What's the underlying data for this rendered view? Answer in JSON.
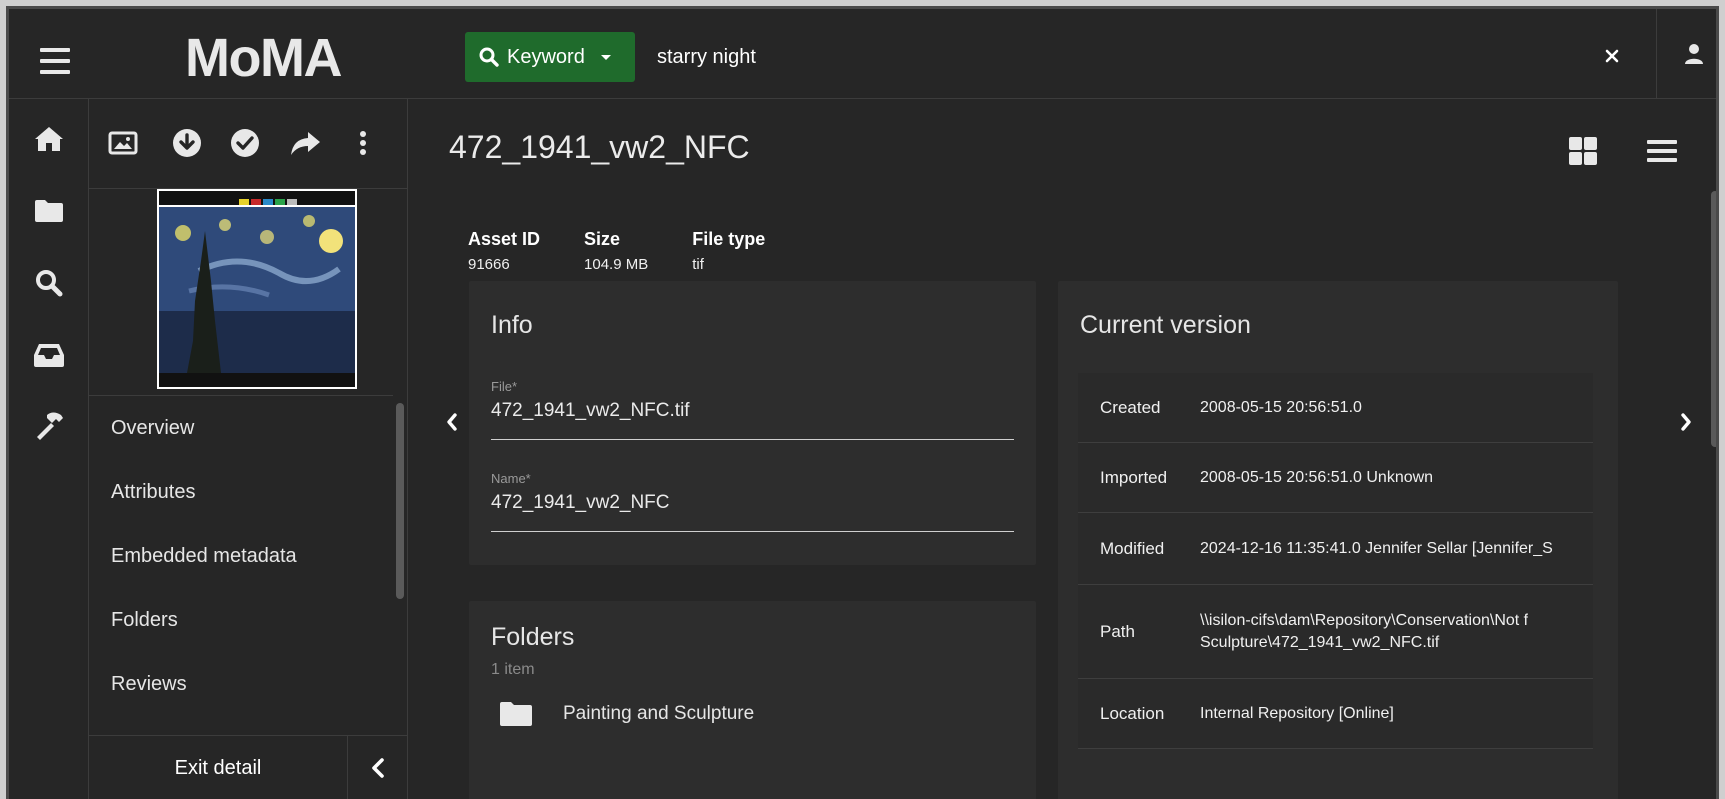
{
  "app": {
    "logo": "MoMA"
  },
  "search": {
    "type_label": "Keyword",
    "query": "starry night"
  },
  "rail": {
    "items": [
      "home",
      "folders",
      "search",
      "inbox",
      "tools"
    ]
  },
  "subpanel": {
    "nav": [
      "Overview",
      "Attributes",
      "Embedded metadata",
      "Folders",
      "Reviews"
    ],
    "exit_label": "Exit detail"
  },
  "asset": {
    "title": "472_1941_vw2_NFC",
    "meta": [
      {
        "key": "Asset ID",
        "value": "91666"
      },
      {
        "key": "Size",
        "value": "104.9 MB"
      },
      {
        "key": "File type",
        "value": "tif"
      }
    ]
  },
  "info_card": {
    "title": "Info",
    "file_label": "File*",
    "file_value": "472_1941_vw2_NFC.tif",
    "name_label": "Name*",
    "name_value": "472_1941_vw2_NFC"
  },
  "folders_card": {
    "title": "Folders",
    "count": "1 item",
    "items": [
      "Painting and Sculpture"
    ]
  },
  "version_card": {
    "title": "Current version",
    "rows": [
      {
        "key": "Created",
        "value": "2008-05-15 20:56:51.0"
      },
      {
        "key": "Imported",
        "value": "2008-05-15 20:56:51.0 Unknown"
      },
      {
        "key": "Modified",
        "value": "2024-12-16 11:35:41.0 Jennifer Sellar [Jennifer_S"
      },
      {
        "key": "Path",
        "value": "\\\\isilon-cifs\\dam\\Repository\\Conservation\\Not f",
        "value2": "Sculpture\\472_1941_vw2_NFC.tif"
      },
      {
        "key": "Location",
        "value": "Internal Repository [Online]"
      }
    ]
  },
  "colors": {
    "background": "#262626",
    "card": "#2d2d2d",
    "accent_green": "#1f6b2c"
  }
}
